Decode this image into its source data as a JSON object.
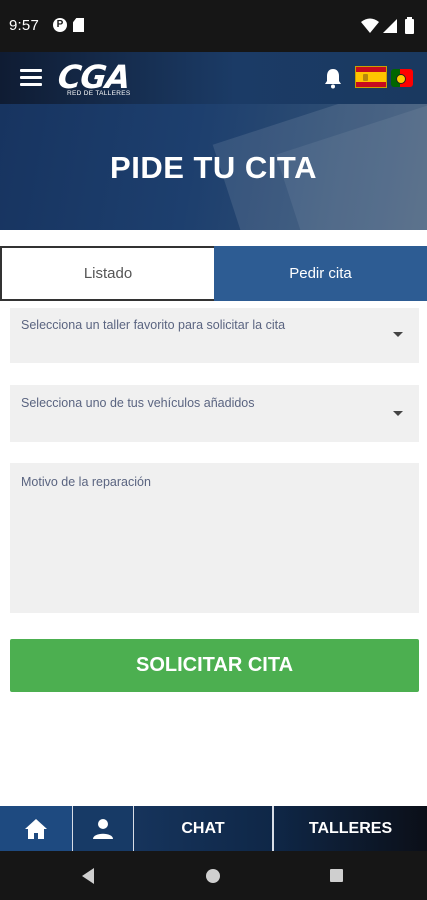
{
  "status_bar": {
    "time": "9:57",
    "app_icon_letter": "P",
    "icons": [
      "p-app-icon",
      "sd-card-icon",
      "wifi-icon",
      "signal-icon",
      "battery-icon"
    ]
  },
  "app_bar": {
    "logo_text": "CGA",
    "logo_subtitle": "RED DE TALLERES",
    "icons": [
      "menu-icon",
      "bell-icon",
      "spain-flag-icon",
      "portugal-flag-icon"
    ]
  },
  "hero": {
    "title": "PIDE TU CITA"
  },
  "tabs": [
    {
      "label": "Listado",
      "active": false
    },
    {
      "label": "Pedir cita",
      "active": true
    }
  ],
  "form": {
    "taller_label": "Selecciona un taller favorito para solicitar la cita",
    "vehiculo_label": "Selecciona uno de tus vehículos añadidos",
    "motivo_label": "Motivo de la reparación",
    "submit_label": "SOLICITAR CITA"
  },
  "bottom_nav": {
    "chat_label": "CHAT",
    "talleres_label": "TALLERES",
    "icons": [
      "home-icon",
      "user-icon"
    ]
  },
  "colors": {
    "primary_blue": "#2d5c93",
    "dark_navy": "#132a4a",
    "submit_green": "#4caf50",
    "field_bg": "#f0f0f0",
    "label_color": "#5a6480"
  }
}
